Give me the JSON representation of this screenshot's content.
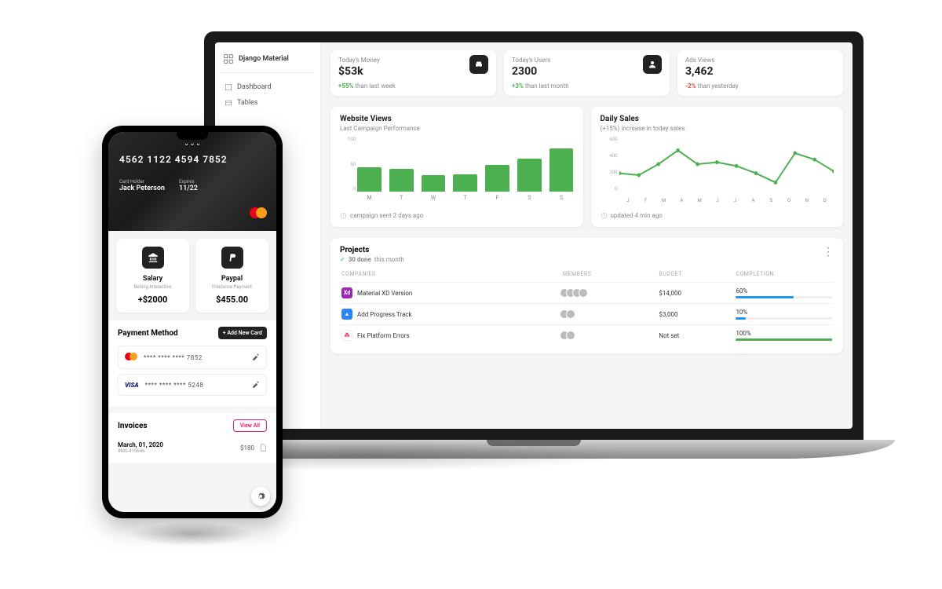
{
  "sidebar": {
    "brand": "Django Material",
    "items": [
      "Dashboard",
      "Tables"
    ]
  },
  "stats": [
    {
      "label": "Today's Money",
      "value": "$53k",
      "pct": "+55%",
      "rest": " than last week",
      "dir": "up",
      "icon": "weekend"
    },
    {
      "label": "Today's Users",
      "value": "2300",
      "pct": "+3%",
      "rest": " than last month",
      "dir": "up",
      "icon": "person"
    },
    {
      "label": "Ads Views",
      "value": "3,462",
      "pct": "-2%",
      "rest": " than yesterday",
      "dir": "down",
      "icon": null
    }
  ],
  "website_views": {
    "title": "Website Views",
    "subtitle": "Last Campaign Performance",
    "footer": "campaign sent 2 days ago"
  },
  "daily_sales": {
    "title": "Daily Sales",
    "subtitle": "(+15%) increase in today sales.",
    "footer": "updated 4 min ago"
  },
  "projects": {
    "title": "Projects",
    "subtitle_count": "30 done",
    "subtitle_rest": " this month",
    "headers": {
      "companies": "COMPANIES",
      "members": "MEMBERS",
      "budget": "BUDGET",
      "completion": "COMPLETION"
    },
    "rows": [
      {
        "icon_bg": "#9c27b0",
        "icon_txt": "Xd",
        "name": "Material XD Version",
        "members": 4,
        "budget": "$14,000",
        "pct": "60%",
        "fill": 60,
        "color": "#2196f3"
      },
      {
        "icon_bg": "#2684ff",
        "icon_txt": "▲",
        "name": "Add Progress Track",
        "members": 2,
        "budget": "$3,000",
        "pct": "10%",
        "fill": 10,
        "color": "#2196f3"
      },
      {
        "icon_bg": "#fff",
        "icon_txt": "⁂",
        "name": "Fix Platform Errors",
        "members": 2,
        "budget": "Not set",
        "pct": "100%",
        "fill": 100,
        "color": "#4caf50"
      }
    ]
  },
  "phone": {
    "card": {
      "number": "4562  1122  4594  7852",
      "holder_label": "Card Holder",
      "holder": "Jack Peterson",
      "expires_label": "Expires",
      "expires": "11/22"
    },
    "blocks": [
      {
        "title": "Salary",
        "sub": "Belong Interactive",
        "value": "+$2000"
      },
      {
        "title": "Paypal",
        "sub": "Freelance Payment",
        "value": "$455.00"
      }
    ],
    "payment": {
      "title": "Payment Method",
      "add": "+ Add New Card",
      "cards": [
        {
          "brand": "mc",
          "mask": "****  ****  ****  7852"
        },
        {
          "brand": "visa",
          "mask": "****  ****  ****  5248"
        }
      ]
    },
    "invoices": {
      "title": "Invoices",
      "view_all": "View All",
      "items": [
        {
          "date": "March, 01, 2020",
          "id": "#MS-415646",
          "amount": "$180"
        }
      ]
    }
  },
  "chart_data": [
    {
      "type": "bar",
      "title": "Website Views",
      "subtitle": "Last Campaign Performance",
      "categories": [
        "M",
        "T",
        "W",
        "T",
        "F",
        "S",
        "S"
      ],
      "values": [
        45,
        42,
        30,
        32,
        48,
        60,
        78
      ],
      "ylabel": "",
      "ylim": [
        0,
        100
      ],
      "yticks": [
        0,
        50,
        100
      ]
    },
    {
      "type": "line",
      "title": "Daily Sales",
      "subtitle": "(+15%) increase in today sales.",
      "x": [
        "J",
        "F",
        "M",
        "A",
        "M",
        "J",
        "J",
        "A",
        "S",
        "O",
        "N",
        "D"
      ],
      "series": [
        {
          "name": "Sales",
          "values": [
            200,
            180,
            300,
            450,
            300,
            320,
            280,
            200,
            100,
            420,
            350,
            220
          ]
        }
      ],
      "ylim": [
        0,
        600
      ],
      "yticks": [
        0,
        200,
        400,
        600
      ]
    }
  ]
}
